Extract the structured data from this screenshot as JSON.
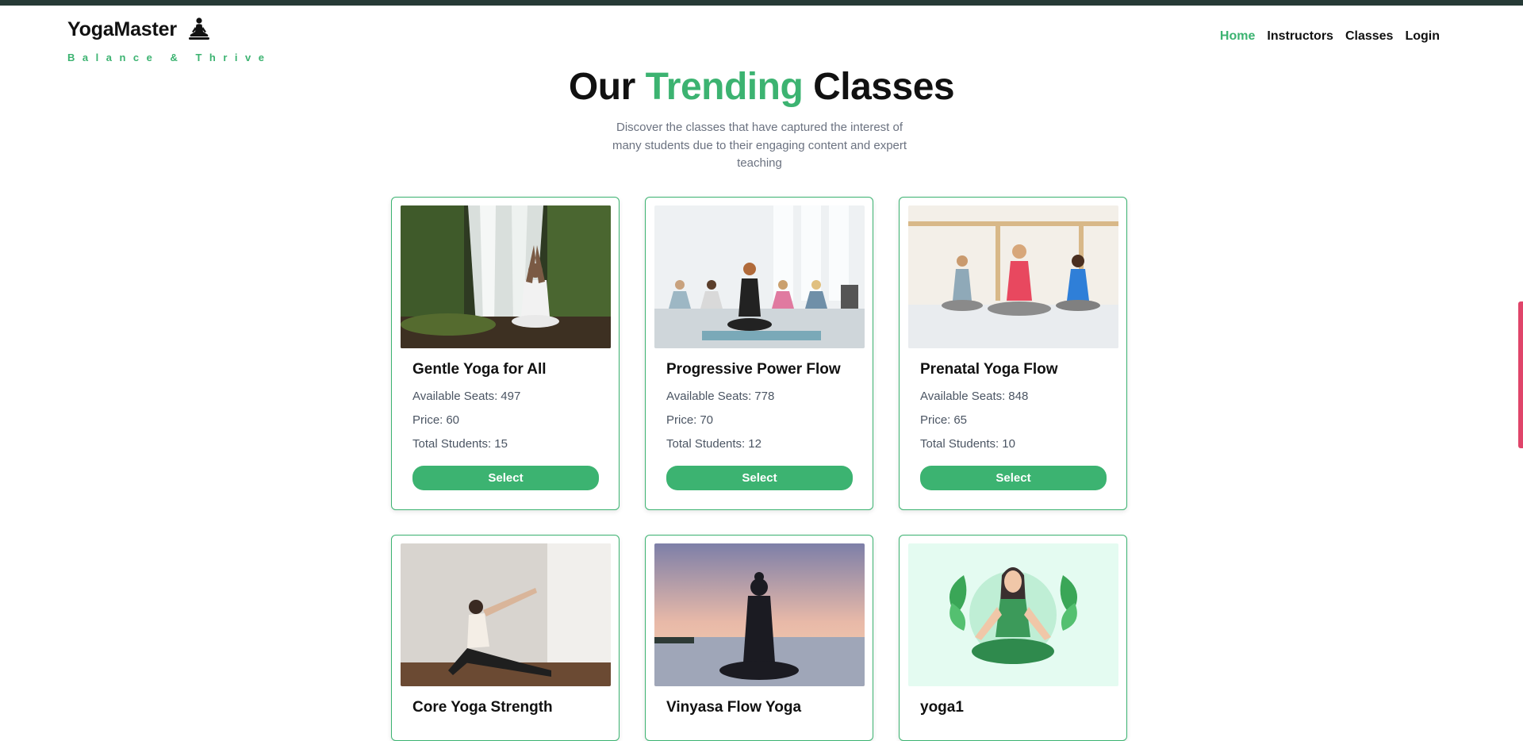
{
  "brand": {
    "name": "YogaMaster",
    "tagline": "Balance & Thrive",
    "logo_icon": "meditation-icon"
  },
  "nav": {
    "items": [
      {
        "label": "Home",
        "active": true
      },
      {
        "label": "Instructors",
        "active": false
      },
      {
        "label": "Classes",
        "active": false
      },
      {
        "label": "Login",
        "active": false
      }
    ]
  },
  "hero": {
    "title_prefix": "Our",
    "title_accent": "Trending",
    "title_suffix": "Classes",
    "description": "Discover the classes that have captured the interest of many students due to their engaging content and expert teaching"
  },
  "labels": {
    "seats": "Available Seats:",
    "price": "Price:",
    "students": "Total Students:",
    "select": "Select"
  },
  "classes": [
    {
      "name": "Gentle Yoga for All",
      "seats": "497",
      "price": "60",
      "students": "15",
      "image": "waterfall-meditation-photo"
    },
    {
      "name": "Progressive Power Flow",
      "seats": "778",
      "price": "70",
      "students": "12",
      "image": "group-meditation-studio-photo"
    },
    {
      "name": "Prenatal Yoga Flow",
      "seats": "848",
      "price": "65",
      "students": "10",
      "image": "three-women-meditating-photo"
    },
    {
      "name": "Core Yoga Strength",
      "image": "side-stretch-pose-photo"
    },
    {
      "name": "Vinyasa Flow Yoga",
      "image": "sunset-silhouette-meditation-photo"
    },
    {
      "name": "yoga1",
      "image": "illustrated-meditating-woman-with-leaves"
    }
  ],
  "colors": {
    "accent": "#3cb371",
    "top_bar": "#263a36",
    "scrollbar_thumb": "#e0456a"
  }
}
